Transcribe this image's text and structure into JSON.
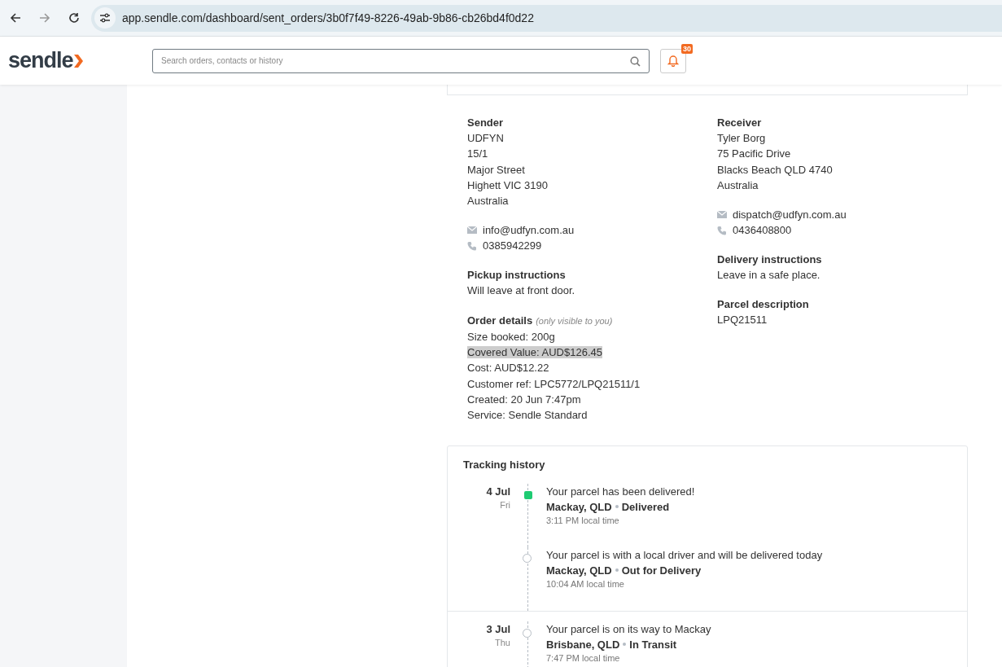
{
  "browser": {
    "url": "app.sendle.com/dashboard/sent_orders/3b0f7f49-8226-49ab-9b86-cb26bd4f0d22"
  },
  "header": {
    "logo": "sendle",
    "search": {
      "placeholder": "Search orders, contacts or history"
    },
    "notifications": {
      "count": "30"
    }
  },
  "sender": {
    "heading": "Sender",
    "address": [
      "UDFYN",
      "15/1",
      "Major Street",
      "Highett VIC 3190",
      "Australia"
    ],
    "email": "info@udfyn.com.au",
    "phone": "0385942299"
  },
  "receiver": {
    "heading": "Receiver",
    "address": [
      "Tyler Borg",
      "75 Pacific Drive",
      "Blacks Beach QLD 4740",
      "Australia"
    ],
    "email": "dispatch@udfyn.com.au",
    "phone": "0436408800"
  },
  "pickup_instructions": {
    "heading": "Pickup instructions",
    "text": "Will leave at front door."
  },
  "delivery_instructions": {
    "heading": "Delivery instructions",
    "text": "Leave in a safe place."
  },
  "parcel_description": {
    "heading": "Parcel description",
    "text": "LPQ21511"
  },
  "order_details": {
    "heading": "Order details",
    "note": "(only visible to you)",
    "lines": [
      {
        "text": "Size booked: 200g",
        "highlighted": false
      },
      {
        "text": "Covered Value: AUD$126.45",
        "highlighted": true
      },
      {
        "text": "Cost: AUD$12.22",
        "highlighted": false
      },
      {
        "text": "Customer ref: LPC5772/LPQ21511/1",
        "highlighted": false
      },
      {
        "text": "Created: 20 Jun 7:47pm",
        "highlighted": false
      },
      {
        "text": "Service: Sendle Standard",
        "highlighted": false
      }
    ]
  },
  "tracking": {
    "title": "Tracking history",
    "days": [
      {
        "date": "4 Jul",
        "weekday": "Fri",
        "events": [
          {
            "kind": "latest",
            "message": "Your parcel has been delivered!",
            "location": "Mackay, QLD",
            "status": "Delivered",
            "time": "3:11 PM local time"
          },
          {
            "kind": "past",
            "message": "Your parcel is with a local driver and will be delivered today",
            "location": "Mackay, QLD",
            "status": "Out for Delivery",
            "time": "10:04 AM local time"
          }
        ]
      },
      {
        "date": "3 Jul",
        "weekday": "Thu",
        "events": [
          {
            "kind": "past",
            "message": "Your parcel is on its way to Mackay",
            "location": "Brisbane, QLD",
            "status": "In Transit",
            "time": "7:47 PM local time"
          }
        ]
      }
    ]
  }
}
